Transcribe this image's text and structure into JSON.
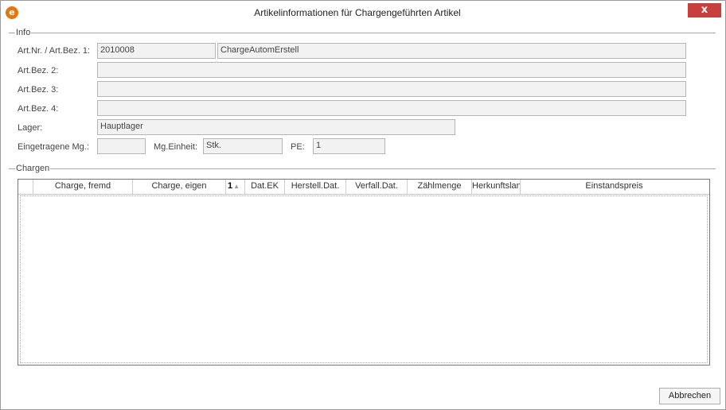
{
  "window": {
    "title": "Artikelinformationen für Chargengeführten Artikel",
    "close_label": "x"
  },
  "info": {
    "group_label": "Info",
    "art_nr_label": "Art.Nr. / Art.Bez. 1:",
    "art_nr_value": "2010008",
    "art_bez1_value": "ChargeAutomErstell",
    "art_bez2_label": "Art.Bez. 2:",
    "art_bez2_value": "",
    "art_bez3_label": "Art.Bez. 3:",
    "art_bez3_value": "",
    "art_bez4_label": "Art.Bez. 4:",
    "art_bez4_value": "",
    "lager_label": "Lager:",
    "lager_value": "Hauptlager",
    "menge_label": "Eingetragene Mg.:",
    "menge_value": "",
    "einheit_label": "Mg.Einheit:",
    "einheit_value": "Stk.",
    "pe_label": "PE:",
    "pe_value": "1"
  },
  "chargen": {
    "group_label": "Chargen",
    "columns": [
      "Charge, fremd",
      "Charge, eigen",
      "Dat.EK",
      "Herstell.Dat.",
      "Verfall.Dat.",
      "Zählmenge",
      "Herkunftsland",
      "Einstandspreis"
    ],
    "sort_number": "1",
    "sort_arrow": "▲",
    "rows": []
  },
  "footer": {
    "cancel_label": "Abbrechen"
  }
}
